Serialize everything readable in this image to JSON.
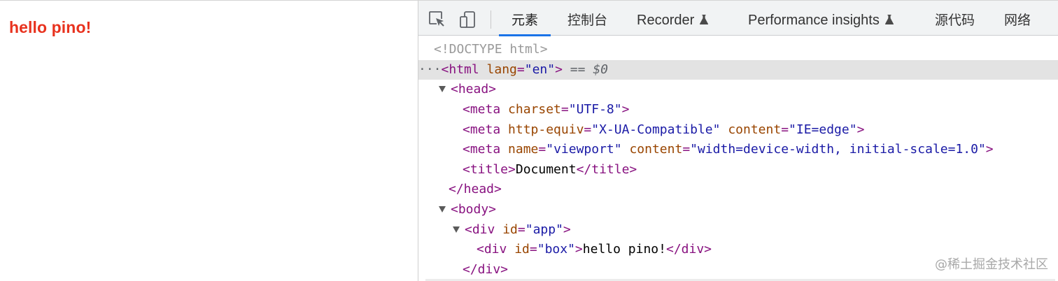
{
  "page": {
    "text": "hello pino!",
    "text_color": "#e8321e"
  },
  "devtools": {
    "tabs": [
      {
        "label": "元素",
        "active": true
      },
      {
        "label": "控制台"
      },
      {
        "label": "Recorder",
        "badge_icon": "flask-icon"
      },
      {
        "label": "Performance insights",
        "badge_icon": "flask-icon"
      },
      {
        "label": "源代码"
      },
      {
        "label": "网络"
      }
    ],
    "tools": [
      "inspect-element-icon",
      "device-toolbar-icon"
    ],
    "accent": "#1a73e8",
    "tree": {
      "doctype": "<!DOCTYPE html>",
      "html_open": "<html",
      "html_attr": "lang",
      "html_val": "\"en\"",
      "html_close": ">",
      "selected_eq": "==",
      "selected_ref": "$0",
      "selected_dots": "···",
      "head_open": "<head>",
      "meta1": {
        "open": "<meta",
        "a1": "charset",
        "v1": "\"UTF-8\"",
        "close": ">"
      },
      "meta2": {
        "open": "<meta",
        "a1": "http-equiv",
        "v1": "\"X-UA-Compatible\"",
        "a2": "content",
        "v2": "\"IE=edge\"",
        "close": ">"
      },
      "meta3": {
        "open": "<meta",
        "a1": "name",
        "v1": "\"viewport\"",
        "a2": "content",
        "v2": "\"width=device-width, initial-scale=1.0\"",
        "close": ">"
      },
      "title": {
        "open": "<title>",
        "text": "Document",
        "close": "</title>"
      },
      "head_close": "</head>",
      "body_open": "<body>",
      "div_app": {
        "open": "<div",
        "a1": "id",
        "v1": "\"app\"",
        "close": ">"
      },
      "div_box": {
        "open": "<div",
        "a1": "id",
        "v1": "\"box\"",
        "close": ">",
        "text": "hello pino!",
        "end": "</div>"
      },
      "div_close": "</div>"
    }
  },
  "watermark": "@稀土掘金技术社区"
}
